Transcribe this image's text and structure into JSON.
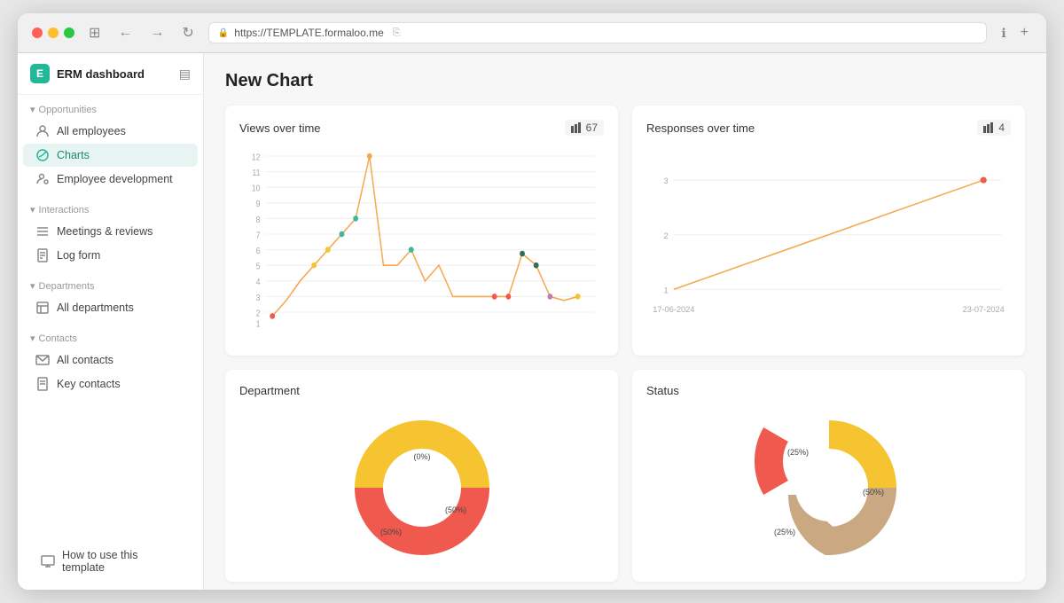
{
  "browser": {
    "url": "https://TEMPLATE.formaloo.me",
    "reload_label": "↻",
    "back_label": "←",
    "forward_label": "→",
    "tab_label": "⊞"
  },
  "app": {
    "logo_letter": "E",
    "title": "ERM dashboard",
    "layout_icon": "▤"
  },
  "sidebar": {
    "sections": [
      {
        "title": "Opportunities",
        "items": [
          {
            "label": "All employees",
            "icon": "person",
            "active": false
          },
          {
            "label": "Charts",
            "icon": "chart",
            "active": true
          },
          {
            "label": "Employee development",
            "icon": "person-gear",
            "active": false
          }
        ]
      },
      {
        "title": "Interactions",
        "items": [
          {
            "label": "Meetings & reviews",
            "icon": "list",
            "active": false
          },
          {
            "label": "Log form",
            "icon": "file",
            "active": false
          }
        ]
      },
      {
        "title": "Departments",
        "items": [
          {
            "label": "All departments",
            "icon": "table",
            "active": false
          }
        ]
      },
      {
        "title": "Contacts",
        "items": [
          {
            "label": "All contacts",
            "icon": "mail",
            "active": false
          },
          {
            "label": "Key contacts",
            "icon": "file",
            "active": false
          }
        ]
      }
    ],
    "footer_item": "How to use this template"
  },
  "main": {
    "page_title": "New Chart",
    "charts": [
      {
        "id": "views-over-time",
        "title": "Views over time",
        "badge": "67",
        "badge_icon": "chart-bar",
        "type": "line"
      },
      {
        "id": "responses-over-time",
        "title": "Responses over time",
        "badge": "4",
        "badge_icon": "chart-bar",
        "type": "line"
      },
      {
        "id": "department",
        "title": "Department",
        "type": "donut",
        "segments": [
          {
            "label": "0%",
            "value": 0,
            "color": "#f05a4e"
          },
          {
            "label": "50%",
            "value": 50,
            "color": "#f5c430"
          },
          {
            "label": "50%",
            "value": 50,
            "color": "#f05a4e"
          }
        ]
      },
      {
        "id": "status",
        "title": "Status",
        "type": "donut",
        "segments": [
          {
            "label": "25%",
            "value": 25,
            "color": "#f5c430"
          },
          {
            "label": "50%",
            "value": 50,
            "color": "#c9a882"
          },
          {
            "label": "25%",
            "value": 25,
            "color": "#f05a4e"
          }
        ]
      }
    ]
  },
  "icons": {
    "person": "👤",
    "chart": "📊",
    "list": "☰",
    "file": "📄",
    "table": "🗂",
    "mail": "✉",
    "chevron_down": "▾",
    "lock": "🔒"
  }
}
